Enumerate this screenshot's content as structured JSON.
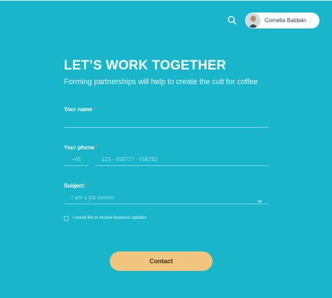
{
  "header": {
    "search_icon": "search-icon",
    "user": {
      "name": "Cornelia Baldwin",
      "caret": "⌄"
    }
  },
  "hero": {
    "title": "LET’S WORK TOGETHER",
    "subtitle": "Forming partnerships will help to create the cult for coffee"
  },
  "form": {
    "name": {
      "label": "Your name",
      "required_mark": "*",
      "value": ""
    },
    "phone": {
      "label": "Your phone",
      "required_mark": "*",
      "code_placeholder": "+45",
      "number_placeholder": "123 - 458777 - 558782"
    },
    "subject": {
      "label": "Subject",
      "required_mark": "*",
      "selected": "I am a job seeker"
    },
    "updates_checkbox": {
      "label": "I would like to receive business updates",
      "checked": false
    },
    "submit_label": "Contact"
  },
  "colors": {
    "background": "#19b6cb",
    "button": "#f2c57e",
    "required": "#f27a6b"
  }
}
